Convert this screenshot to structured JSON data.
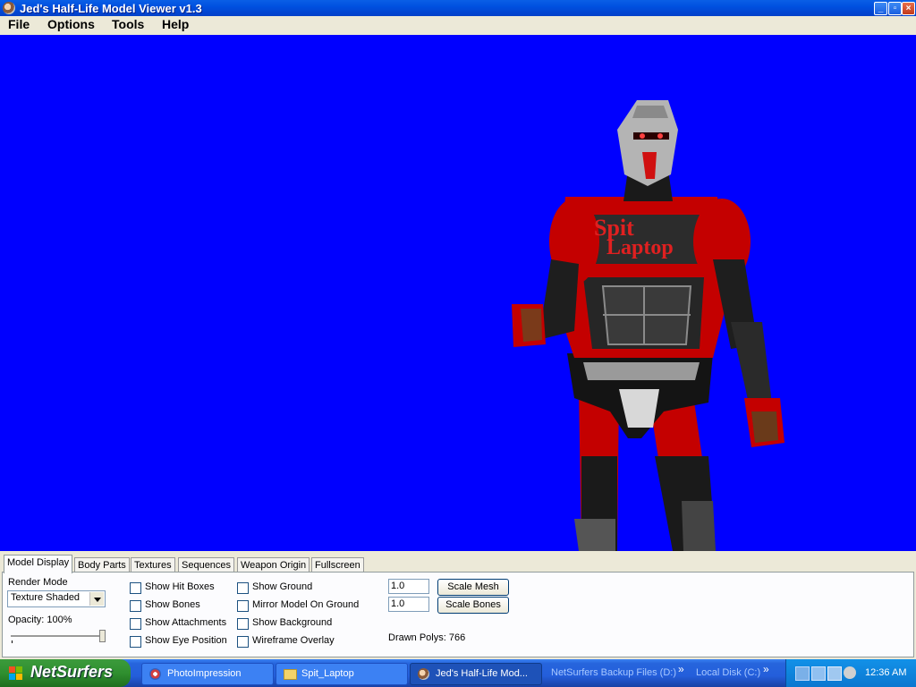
{
  "window": {
    "title": "Jed's Half-Life Model Viewer v1.3"
  },
  "menu": [
    "File",
    "Options",
    "Tools",
    "Help"
  ],
  "model": {
    "shirt_line1": "Spit",
    "shirt_line2": "Laptop"
  },
  "tabs": [
    "Model Display",
    "Body Parts",
    "Textures",
    "Sequences",
    "Weapon Origin",
    "Fullscreen"
  ],
  "display": {
    "render_mode_label": "Render Mode",
    "render_mode_value": "Texture Shaded",
    "opacity_label": "Opacity: 100%",
    "opacity_value": 1.0,
    "checkboxes_col1": [
      "Show Hit Boxes",
      "Show Bones",
      "Show Attachments",
      "Show Eye Position"
    ],
    "checkboxes_col2": [
      "Show Ground",
      "Mirror Model On Ground",
      "Show Background",
      "Wireframe Overlay"
    ],
    "scale_mesh_value": "1.0",
    "scale_bones_value": "1.0",
    "scale_mesh_button": "Scale Mesh",
    "scale_bones_button": "Scale Bones",
    "drawn_polys": "Drawn Polys: 766"
  },
  "taskbar": {
    "start_label": "NetSurfers",
    "tasks": [
      "PhotoImpression",
      "Spit_Laptop",
      "Jed's Half-Life Mod..."
    ],
    "links": [
      "NetSurfers Backup Files (D:)",
      "Local Disk (C:)"
    ],
    "clock": "12:36 AM"
  },
  "colors": {
    "viewport_bg": "#0000ff",
    "titlebar": "#0050e0",
    "taskbar": "#245edb",
    "start": "#2f8f2f"
  }
}
